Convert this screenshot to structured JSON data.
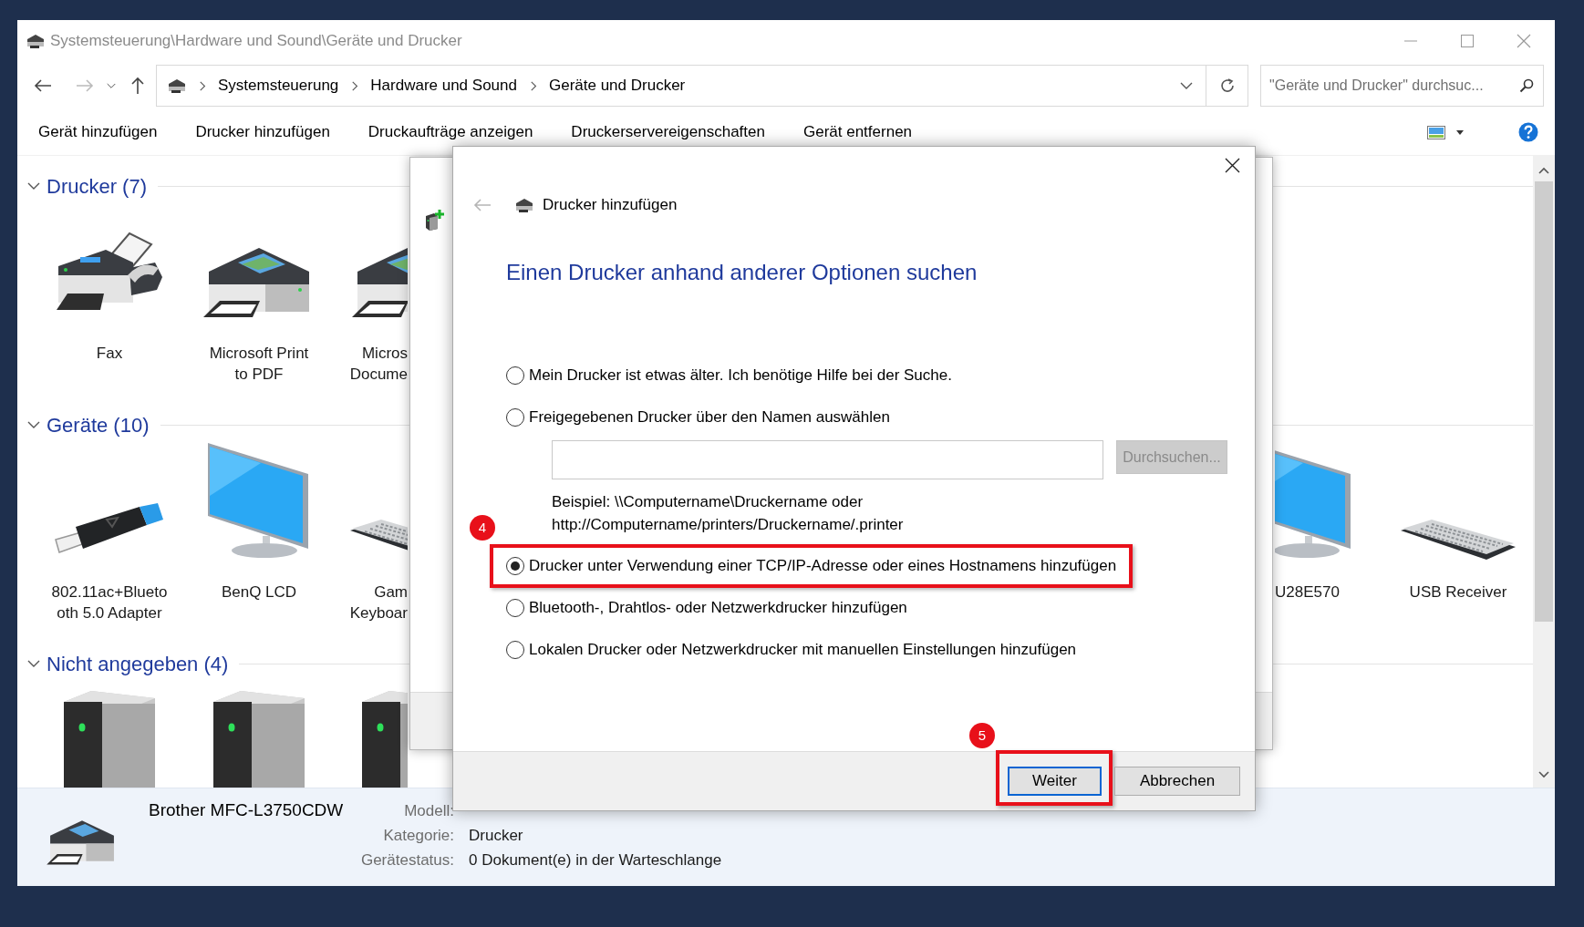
{
  "window": {
    "title": "Systemsteuerung\\Hardware und Sound\\Geräte und Drucker"
  },
  "nav": {
    "forward_enabled": false
  },
  "address_bar": {
    "segments": [
      "Systemsteuerung",
      "Hardware und Sound",
      "Geräte und Drucker"
    ]
  },
  "search": {
    "placeholder": "\"Geräte und Drucker\" durchsuc..."
  },
  "toolbar": [
    "Gerät hinzufügen",
    "Drucker hinzufügen",
    "Druckaufträge anzeigen",
    "Druckerservereigenschaften",
    "Gerät entfernen"
  ],
  "sections": [
    {
      "title": "Drucker (7)",
      "expanded": true,
      "items": [
        {
          "kind": "fax",
          "lines": [
            "Fax"
          ]
        },
        {
          "kind": "printer",
          "lines": [
            "Microsoft Print",
            "to PDF"
          ]
        },
        {
          "kind": "printer",
          "lines": [
            "Micros",
            "Docume"
          ],
          "cut_right": true
        }
      ]
    },
    {
      "title": "Geräte (10)",
      "expanded": true,
      "items": [
        {
          "kind": "usb",
          "lines": [
            "802.11ac+Blueto",
            "oth 5.0 Adapter"
          ]
        },
        {
          "kind": "monitor",
          "lines": [
            "BenQ LCD"
          ]
        },
        {
          "kind": "keyboard",
          "lines": [
            "Gam",
            "Keyboar"
          ],
          "cut_right": true
        }
      ],
      "right_items": [
        {
          "kind": "monitor",
          "lines": [
            "U28E570"
          ],
          "cut_left": true
        },
        {
          "kind": "keyboard",
          "lines": [
            "USB Receiver"
          ]
        }
      ]
    },
    {
      "title": "Nicht angegeben (4)",
      "expanded": true,
      "items": [
        {
          "kind": "tower"
        },
        {
          "kind": "tower"
        },
        {
          "kind": "tower",
          "cut_right": true
        }
      ]
    }
  ],
  "dialog": {
    "title": "Drucker hinzufügen",
    "back_enabled": false,
    "heading": "Einen Drucker anhand anderer Optionen suchen",
    "options": [
      {
        "label": "Mein Drucker ist etwas älter. Ich benötige Hilfe bei der Suche.",
        "selected": false,
        "highlighted": false
      },
      {
        "label": "Freigegebenen Drucker über den Namen auswählen",
        "selected": false,
        "highlighted": false,
        "name_field": {
          "browse_button": "Durchsuchen...",
          "browse_disabled": true,
          "example_lines": [
            "Beispiel: \\\\Computername\\Druckername oder",
            "http://Computername/printers/Druckername/.printer"
          ]
        }
      },
      {
        "label": "Drucker unter Verwendung einer TCP/IP-Adresse oder eines Hostnamens hinzufügen",
        "selected": true,
        "highlighted": true,
        "badge": "4"
      },
      {
        "label": "Bluetooth-, Drahtlos- oder Netzwerkdrucker hinzufügen",
        "selected": false,
        "highlighted": false
      },
      {
        "label": "Lokalen Drucker oder Netzwerkdrucker mit manuellen Einstellungen hinzufügen",
        "selected": false,
        "highlighted": false
      }
    ],
    "buttons": [
      {
        "label": "Weiter",
        "default": true,
        "highlighted": true,
        "badge": "5"
      },
      {
        "label": "Abbrechen",
        "default": false,
        "highlighted": false
      }
    ]
  },
  "details": {
    "name": "Brother MFC-L3750CDW",
    "fields": [
      {
        "label": "Modell:"
      },
      {
        "label": "Kategorie:",
        "value": "Drucker"
      },
      {
        "label": "Gerätestatus:",
        "value": "0 Dokument(e) in der Warteschlange"
      }
    ]
  }
}
